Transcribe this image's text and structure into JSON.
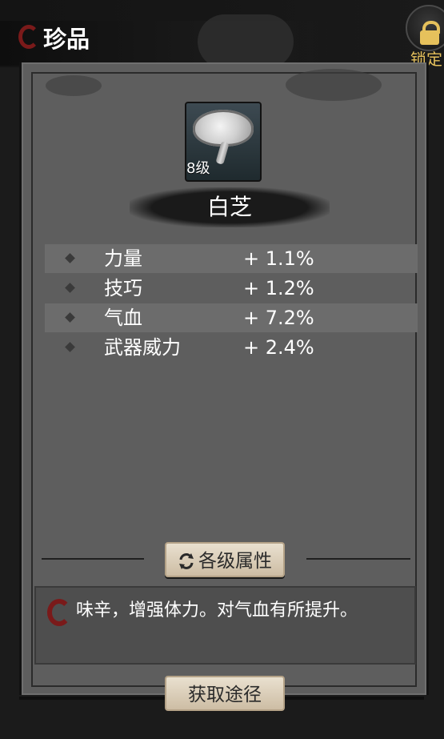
{
  "header": {
    "title": "珍品"
  },
  "lock": {
    "label": "锁定",
    "color": "#e6c15c"
  },
  "item": {
    "name": "白芝",
    "level": "8级"
  },
  "attributes": [
    {
      "name": "力量",
      "value": "+ 1.1%"
    },
    {
      "name": "技巧",
      "value": "+ 1.2%"
    },
    {
      "name": "气血",
      "value": "+ 7.2%"
    },
    {
      "name": "武器威力",
      "value": "+ 2.4%"
    }
  ],
  "buttons": {
    "levels": "各级属性",
    "obtain": "获取途径"
  },
  "description": "味辛，增强体力。对气血有所提升。",
  "icons": [
    "lock-icon",
    "refresh-icon",
    "diamond-bullet-icon",
    "brand-mark-icon"
  ],
  "colors": {
    "frame": "#5e5e5e",
    "accent_red": "#7a1a1a",
    "button": "#e9e0cf"
  }
}
